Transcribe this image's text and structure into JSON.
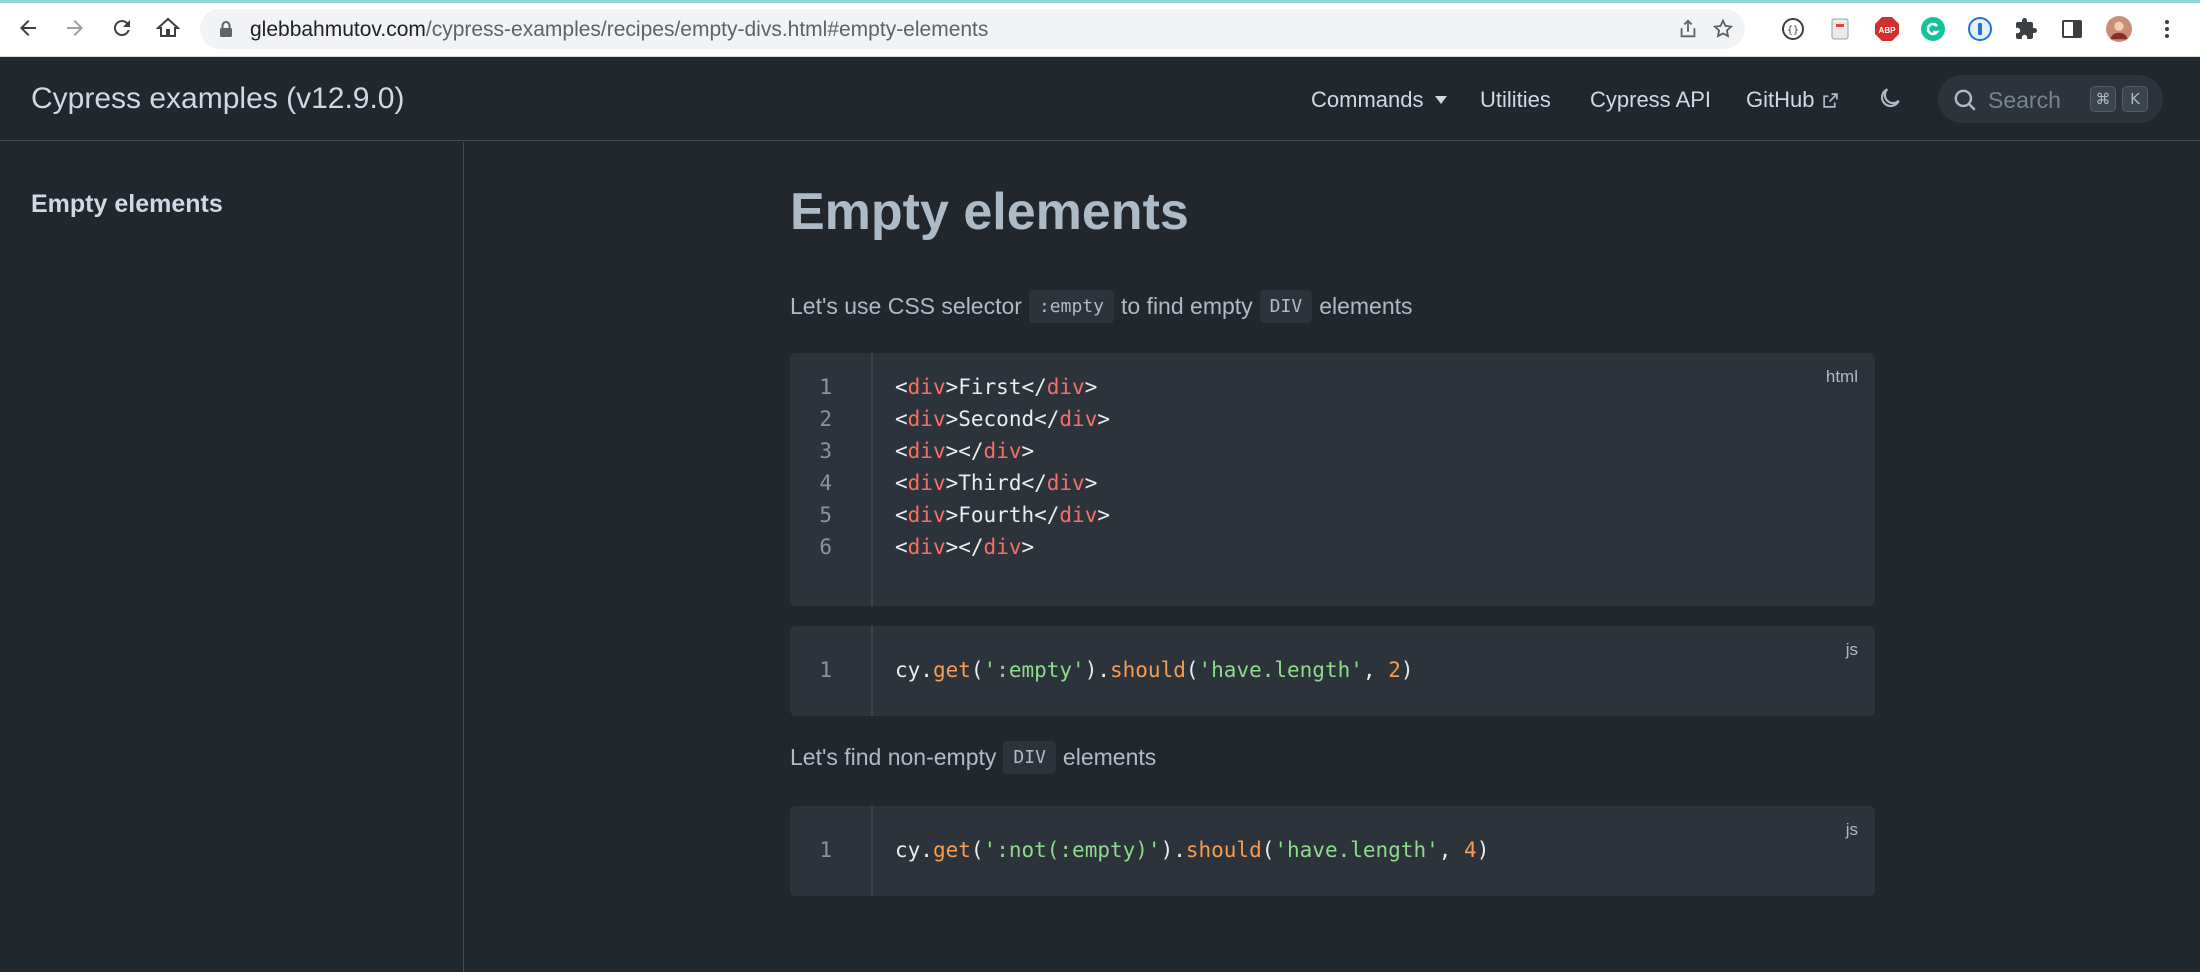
{
  "browser": {
    "url_host": "glebbahmutov.com",
    "url_path": "/cypress-examples/recipes/empty-divs.html#empty-elements",
    "ext_abp_label": "ABP"
  },
  "header": {
    "site_title": "Cypress examples (v12.9.0)",
    "nav": {
      "commands": "Commands",
      "utilities": "Utilities",
      "cypress_api": "Cypress API",
      "github": "GitHub"
    },
    "search_label": "Search",
    "kbd_cmd": "⌘",
    "kbd_k": "K"
  },
  "sidebar": {
    "items": [
      {
        "label": "Empty elements"
      }
    ]
  },
  "main": {
    "title": "Empty elements",
    "para1": {
      "before": "Let's use CSS selector",
      "code1": ":empty",
      "middle": "to find empty",
      "code2": "DIV",
      "after": "elements"
    },
    "para2": {
      "before": "Let's find non-empty",
      "code": "DIV",
      "after": "elements"
    },
    "code_blocks": [
      {
        "lang": "html",
        "lines": [
          {
            "n": "1",
            "t1": "<",
            "tag": "div",
            "t2": ">",
            "text": "First",
            "t3": "</",
            "tag2": "div",
            "t4": ">"
          },
          {
            "n": "2",
            "t1": "<",
            "tag": "div",
            "t2": ">",
            "text": "Second",
            "t3": "</",
            "tag2": "div",
            "t4": ">"
          },
          {
            "n": "3",
            "t1": "<",
            "tag": "div",
            "t2": ">",
            "text": "",
            "t3": "</",
            "tag2": "div",
            "t4": ">"
          },
          {
            "n": "4",
            "t1": "<",
            "tag": "div",
            "t2": ">",
            "text": "Third",
            "t3": "</",
            "tag2": "div",
            "t4": ">"
          },
          {
            "n": "5",
            "t1": "<",
            "tag": "div",
            "t2": ">",
            "text": "Fourth",
            "t3": "</",
            "tag2": "div",
            "t4": ">"
          },
          {
            "n": "6",
            "t1": "<",
            "tag": "div",
            "t2": ">",
            "text": "",
            "t3": "</",
            "tag2": "div",
            "t4": ">"
          }
        ]
      },
      {
        "lang": "js",
        "line": {
          "n": "1",
          "obj": "cy",
          "dot1": ".",
          "fn1": "get",
          "p1": "(",
          "s1": "':empty'",
          "p2": ").",
          "fn2": "should",
          "p3": "(",
          "s2": "'have.length'",
          "comma": ", ",
          "num": "2",
          "p4": ")"
        }
      },
      {
        "lang": "js",
        "line": {
          "n": "1",
          "obj": "cy",
          "dot1": ".",
          "fn1": "get",
          "p1": "(",
          "s1": "':not(:empty)'",
          "p2": ").",
          "fn2": "should",
          "p3": "(",
          "s2": "'have.length'",
          "comma": ", ",
          "num": "4",
          "p4": ")"
        }
      }
    ]
  },
  "colors": {
    "background": "#22272e",
    "code_bg": "#2d333b",
    "tag": "#f47067",
    "function": "#f69d50",
    "string": "#8ddb8c"
  }
}
